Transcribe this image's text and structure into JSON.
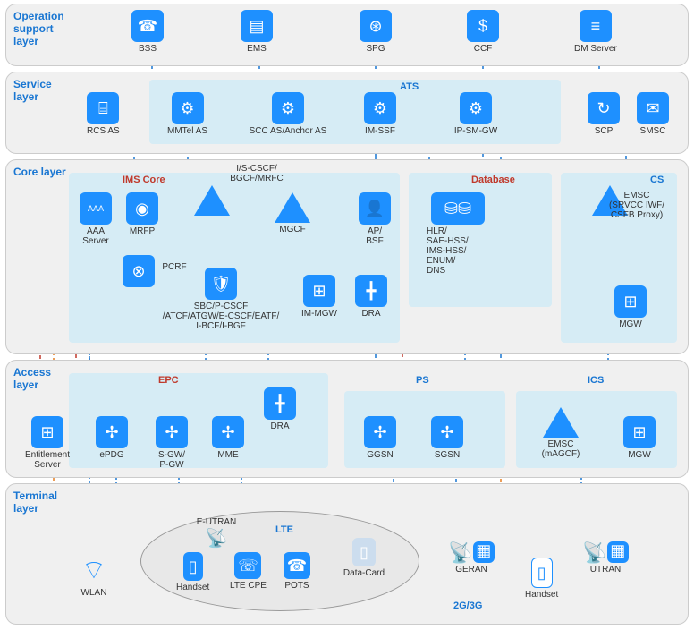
{
  "layers": {
    "op": {
      "title": "Operation support layer"
    },
    "svc": {
      "title": "Service layer"
    },
    "core": {
      "title": "Core layer"
    },
    "acc": {
      "title": "Access layer"
    },
    "term": {
      "title": "Terminal layer"
    }
  },
  "groups": {
    "ats": "ATS",
    "ims": "IMS Core",
    "db": "Database",
    "cs": "CS",
    "epc": "EPC",
    "ps": "PS",
    "ics": "ICS",
    "lte": "LTE",
    "g23": "2G/3G"
  },
  "nodes": {
    "bss": "BSS",
    "ems": "EMS",
    "spg": "SPG",
    "ccf": "CCF",
    "dmserver": "DM Server",
    "rcsas": "RCS AS",
    "mmtelas": "MMTel AS",
    "sccas": "SCC AS/Anchor AS",
    "imssf": "IM-SSF",
    "ipsmgw": "IP-SM-GW",
    "scp": "SCP",
    "smsc": "SMSC",
    "aaa": "AAA\nServer",
    "mrfp": "MRFP",
    "cscf": "I/S-CSCF/\nBGCF/MRFC",
    "mgcf": "MGCF",
    "apbsf": "AP/\nBSF",
    "hlr": "HLR/\nSAE-HSS/\nIMS-HSS/\nENUM/\nDNS",
    "emsc": "EMSC\n(SRVCC IWF/\nCSFB Proxy)",
    "pcrf": "PCRF",
    "sbc": "SBC/P-CSCF\n/ATCF/ATGW/E-CSCF/EATF/\nI-BCF/I-BGF",
    "immgw": "IM-MGW",
    "dra1": "DRA",
    "mgw1": "MGW",
    "ent": "Entitlement\nServer",
    "epdg": "ePDG",
    "sgw": "S-GW/\nP-GW",
    "mme": "MME",
    "dra2": "DRA",
    "ggsn": "GGSN",
    "sgsn": "SGSN",
    "emsc2": "EMSC\n(mAGCF)",
    "mgw2": "MGW",
    "wlan": "WLAN",
    "eutran": "E-UTRAN",
    "handset1": "Handset",
    "ltecpe": "LTE CPE",
    "pots": "POTS",
    "datacard": "Data-Card",
    "geran": "GERAN",
    "handset2": "Handset",
    "utran": "UTRAN"
  }
}
